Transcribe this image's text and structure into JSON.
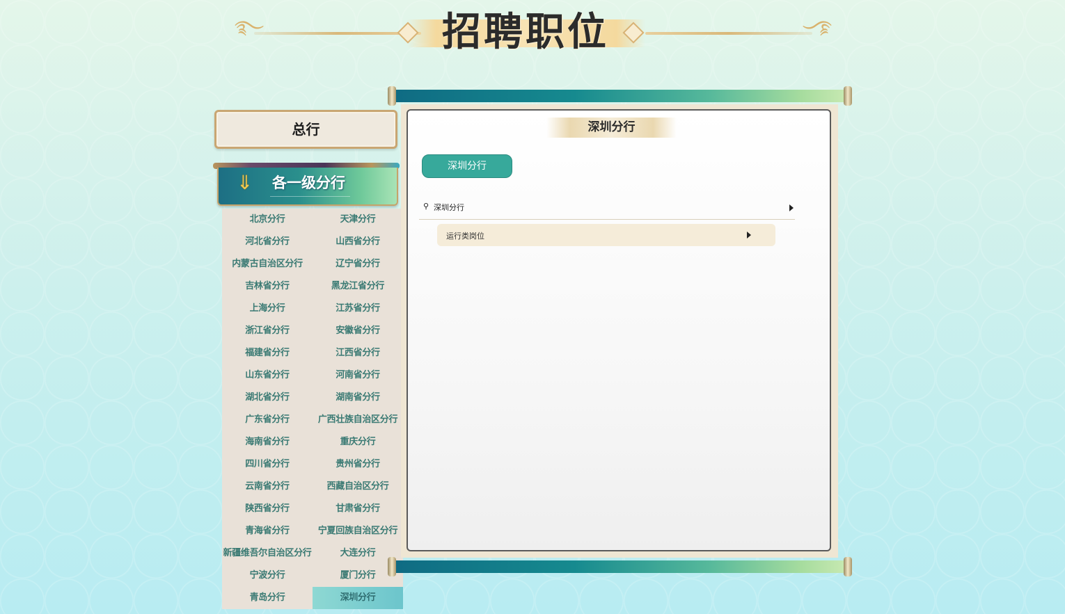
{
  "header": {
    "title": "招聘职位"
  },
  "sidebar": {
    "hq_label": "总行",
    "branches_header": "各一级分行",
    "branches": [
      "北京分行",
      "天津分行",
      "河北省分行",
      "山西省分行",
      "内蒙古自治区分行",
      "辽宁省分行",
      "吉林省分行",
      "黑龙江省分行",
      "上海分行",
      "江苏省分行",
      "浙江省分行",
      "安徽省分行",
      "福建省分行",
      "江西省分行",
      "山东省分行",
      "河南省分行",
      "湖北省分行",
      "湖南省分行",
      "广东省分行",
      "广西壮族自治区分行",
      "海南省分行",
      "重庆分行",
      "四川省分行",
      "贵州省分行",
      "云南省分行",
      "西藏自治区分行",
      "陕西省分行",
      "甘肃省分行",
      "青海省分行",
      "宁夏回族自治区分行",
      "新疆维吾尔自治区分行",
      "大连分行",
      "宁波分行",
      "厦门分行",
      "青岛分行",
      "深圳分行"
    ],
    "selected": "深圳分行"
  },
  "main": {
    "panel_title": "深圳分行",
    "branch_button": "深圳分行",
    "location": "深圳分行",
    "category": "运行类岗位"
  },
  "colors": {
    "accent_teal": "#37a99b",
    "branch_text": "#3a7a73",
    "gold_border": "#c9a672"
  }
}
